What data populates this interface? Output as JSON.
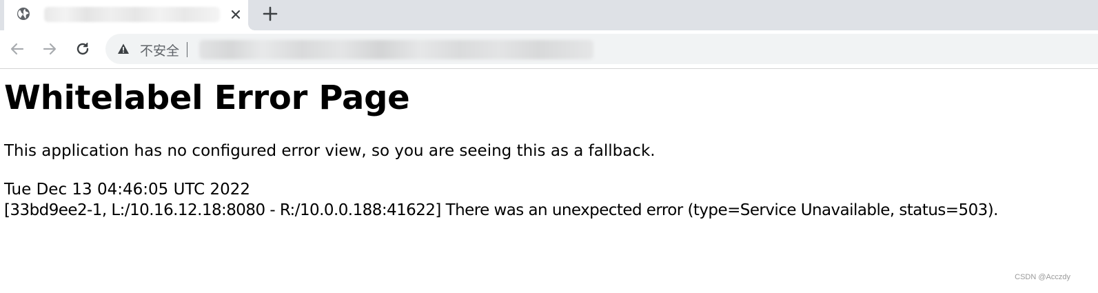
{
  "browser": {
    "tab": {
      "title": "",
      "close_label": "✕",
      "new_tab_label": "+",
      "favicon": "globe-icon"
    },
    "toolbar": {
      "back": "←",
      "forward": "→",
      "reload": "↻",
      "security_label": "不安全",
      "url": ""
    }
  },
  "page": {
    "title": "Whitelabel Error Page",
    "description": "This application has no configured error view, so you are seeing this as a fallback.",
    "timestamp": "Tue Dec 13 04:46:05 UTC 2022",
    "error_detail": "[33bd9ee2-1, L:/10.16.12.18:8080 - R:/10.0.0.188:41622] There was an unexpected error (type=Service Unavailable, status=503)."
  },
  "watermark": "CSDN @Acczdy",
  "colors": {
    "tab_strip": "#dee1e6",
    "omnibox": "#f1f3f4",
    "icon_gray": "#5f6368"
  }
}
